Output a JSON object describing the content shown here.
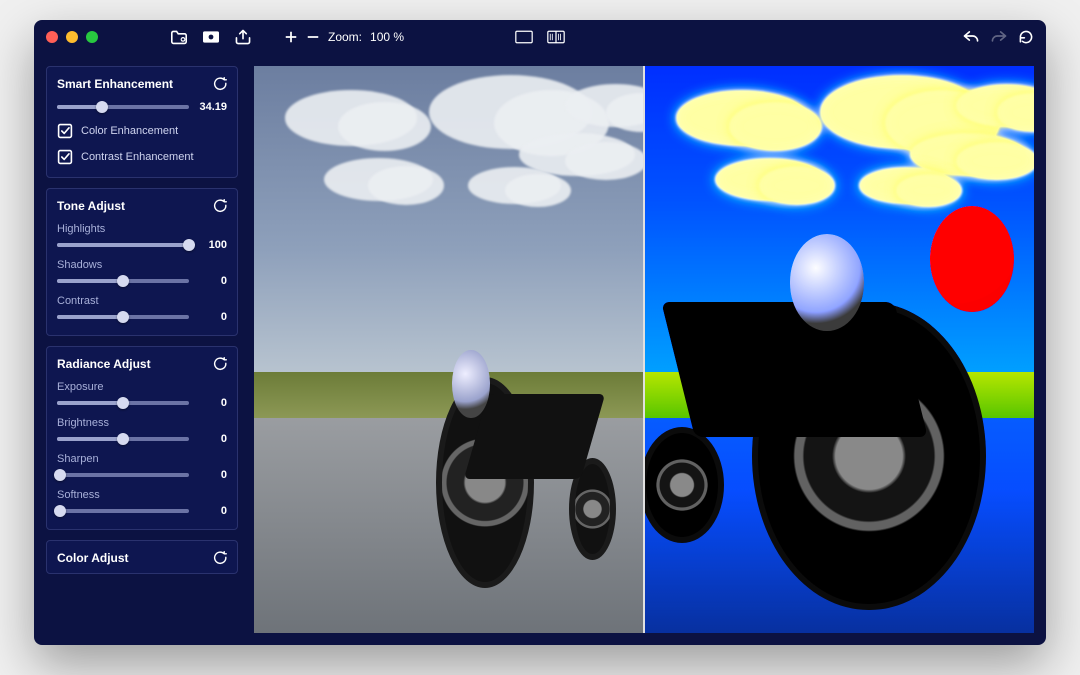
{
  "toolbar": {
    "zoom_label": "Zoom:",
    "zoom_value": "100 %"
  },
  "panels": {
    "smart": {
      "title": "Smart Enhancement",
      "amount_value": "34.19",
      "amount_pct": 34.19,
      "color_enh_label": "Color Enhancement",
      "color_enh_checked": true,
      "contrast_enh_label": "Contrast Enhancement",
      "contrast_enh_checked": true
    },
    "tone": {
      "title": "Tone Adjust",
      "controls": [
        {
          "label": "Highlights",
          "value": "100",
          "pct": 100
        },
        {
          "label": "Shadows",
          "value": "0",
          "pct": 50
        },
        {
          "label": "Contrast",
          "value": "0",
          "pct": 50
        }
      ]
    },
    "radiance": {
      "title": "Radiance Adjust",
      "controls": [
        {
          "label": "Exposure",
          "value": "0",
          "pct": 50
        },
        {
          "label": "Brightness",
          "value": "0",
          "pct": 50
        },
        {
          "label": "Sharpen",
          "value": "0",
          "pct": 2
        },
        {
          "label": "Softness",
          "value": "0",
          "pct": 2
        }
      ]
    },
    "color": {
      "title": "Color Adjust"
    }
  }
}
